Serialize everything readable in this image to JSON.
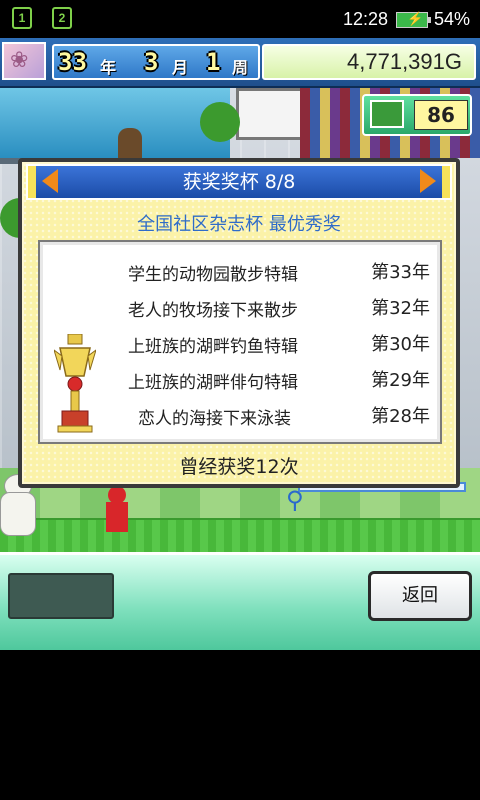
{
  "status_bar": {
    "notif1": "1",
    "notif2": "2",
    "time": "12:28",
    "battery_percent": "54%"
  },
  "hud": {
    "year": "33",
    "year_unit": "年",
    "month": "3",
    "month_unit": "月",
    "week": "1",
    "week_unit": "周",
    "money": "4,771,391G",
    "research_points": "86"
  },
  "dialog": {
    "title": "获奖奖杯 8/8",
    "subtitle": "全国社区杂志杯 最优秀奖",
    "awards": [
      {
        "name": "学生的动物园散步特辑",
        "year": "第33年"
      },
      {
        "name": "老人的牧场接下来散步",
        "year": "第32年"
      },
      {
        "name": "上班族的湖畔钓鱼特辑",
        "year": "第30年"
      },
      {
        "name": "上班族的湖畔俳句特辑",
        "year": "第29年"
      },
      {
        "name": "恋人的海接下来泳装",
        "year": "第28年"
      }
    ],
    "footer": "曾经获奖12次"
  },
  "bottom_panel": {
    "back_label": "返回"
  },
  "colors": {
    "dialog_bg": "#fbf2a8",
    "header_blue": "#1b4ca8",
    "arrow_orange": "#f08a1a",
    "subtitle_blue": "#2f6cc8",
    "panel_green": "#7fe0bd"
  }
}
